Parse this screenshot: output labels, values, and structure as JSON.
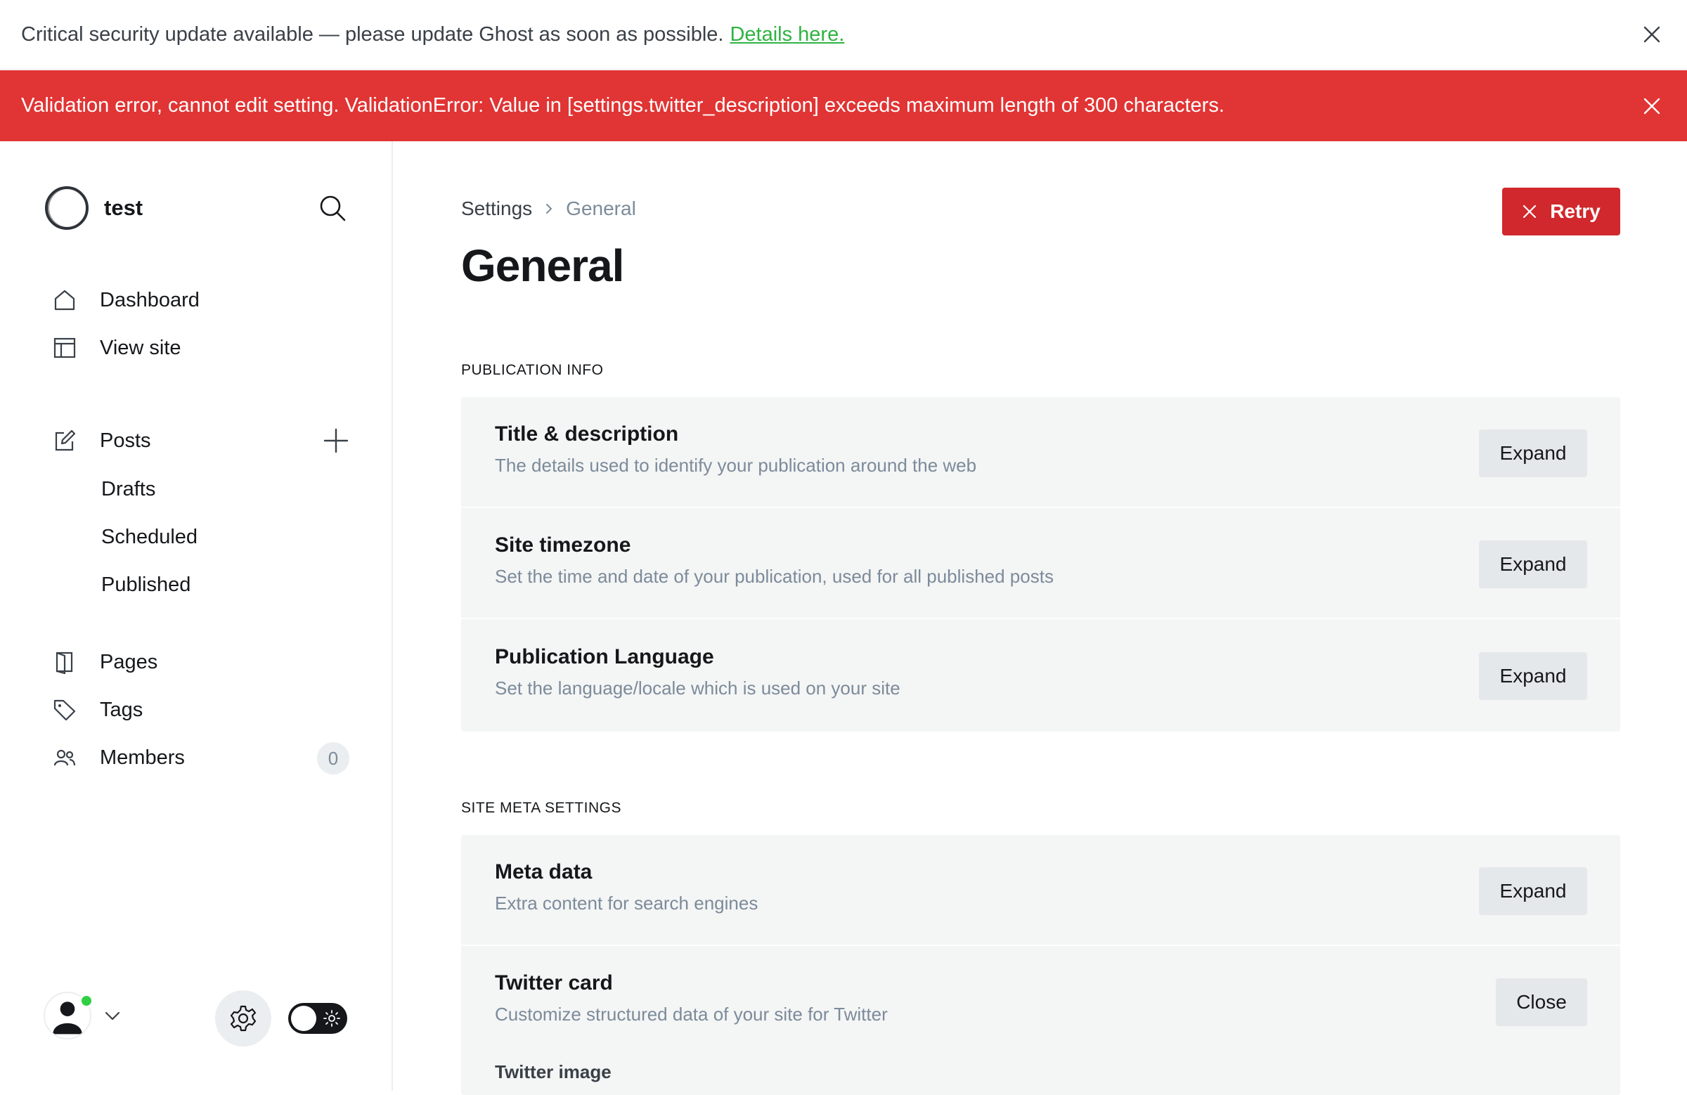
{
  "banner_update": {
    "text": "Critical security update available — please update Ghost as soon as possible.",
    "link": "Details here."
  },
  "banner_error": {
    "text": "Validation error, cannot edit setting. ValidationError: Value in [settings.twitter_description] exceeds maximum length of 300 characters."
  },
  "sidebar": {
    "site_name": "test",
    "nav": {
      "dashboard": "Dashboard",
      "view_site": "View site",
      "posts": "Posts",
      "drafts": "Drafts",
      "scheduled": "Scheduled",
      "published": "Published",
      "pages": "Pages",
      "tags": "Tags",
      "members": "Members",
      "members_count": "0"
    }
  },
  "main": {
    "breadcrumb": {
      "parent": "Settings",
      "current": "General"
    },
    "retry_label": "Retry",
    "title": "General",
    "sections": [
      {
        "heading": "PUBLICATION INFO",
        "rows": [
          {
            "title": "Title & description",
            "desc": "The details used to identify your publication around the web",
            "button": "Expand"
          },
          {
            "title": "Site timezone",
            "desc": "Set the time and date of your publication, used for all published posts",
            "button": "Expand"
          },
          {
            "title": "Publication Language",
            "desc": "Set the language/locale which is used on your site",
            "button": "Expand"
          }
        ]
      },
      {
        "heading": "SITE META SETTINGS",
        "rows": [
          {
            "title": "Meta data",
            "desc": "Extra content for search engines",
            "button": "Expand"
          },
          {
            "title": "Twitter card",
            "desc": "Customize structured data of your site for Twitter",
            "button": "Close",
            "sub_label": "Twitter image"
          }
        ]
      }
    ]
  },
  "colors": {
    "error_banner": "#e13434",
    "retry_button": "#d0282c",
    "link_green": "#2fb341",
    "online_dot": "#30cf43"
  }
}
